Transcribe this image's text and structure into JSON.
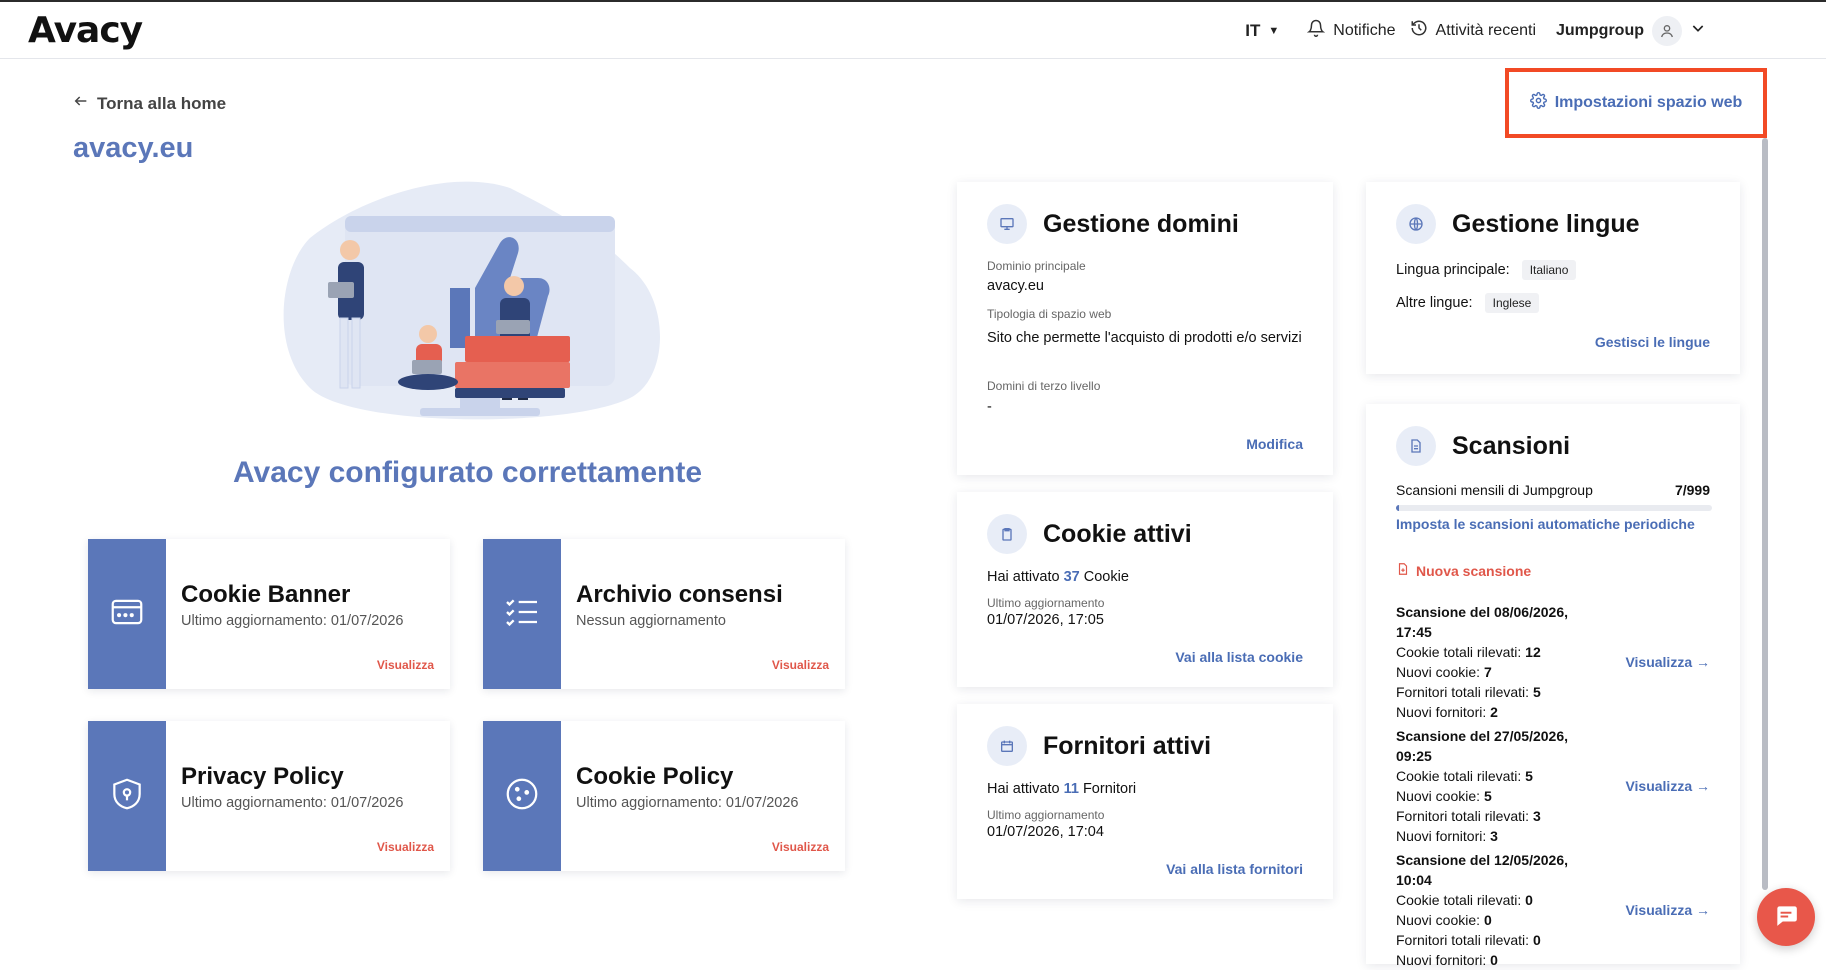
{
  "header": {
    "logo": "Avacy",
    "language": "IT",
    "notifications": "Notifiche",
    "recent_activity": "Attività recenti",
    "organization": "Jumpgroup"
  },
  "page": {
    "back_label": "Torna alla home",
    "site_title": "avacy.eu",
    "settings_label": "Impostazioni spazio web",
    "status_message": "Avacy configurato correttamente"
  },
  "tiles": [
    {
      "title": "Cookie Banner",
      "subtitle": "Ultimo aggiornamento: 01/07/2026",
      "link": "Visualizza",
      "icon": "browser-window-icon"
    },
    {
      "title": "Archivio consensi",
      "subtitle": "Nessun aggiornamento",
      "link": "Visualizza",
      "icon": "checklist-icon"
    },
    {
      "title": "Privacy Policy",
      "subtitle": "Ultimo aggiornamento: 01/07/2026",
      "link": "Visualizza",
      "icon": "shield-icon"
    },
    {
      "title": "Cookie Policy",
      "subtitle": "Ultimo aggiornamento: 01/07/2026",
      "link": "Visualizza",
      "icon": "cookie-icon"
    }
  ],
  "domains": {
    "title": "Gestione domini",
    "main_domain_label": "Dominio principale",
    "main_domain": "avacy.eu",
    "type_label": "Tipologia di spazio web",
    "type_value": "Sito che permette l'acquisto di prodotti e/o servizi",
    "third_level_label": "Domini di terzo livello",
    "third_level_value": "-",
    "action": "Modifica"
  },
  "cookies": {
    "title": "Cookie attivi",
    "prefix": "Hai attivato",
    "count": "37",
    "suffix": "Cookie",
    "updated_label": "Ultimo aggiornamento",
    "updated_value": "01/07/2026, 17:05",
    "action": "Vai alla lista cookie"
  },
  "vendors": {
    "title": "Fornitori attivi",
    "prefix": "Hai attivato",
    "count": "11",
    "suffix": "Fornitori",
    "updated_label": "Ultimo aggiornamento",
    "updated_value": "01/07/2026, 17:04",
    "action": "Vai alla lista fornitori"
  },
  "languages": {
    "title": "Gestione lingue",
    "primary_label": "Lingua principale:",
    "primary_value": "Italiano",
    "others_label": "Altre lingue:",
    "others_value": "Inglese",
    "action": "Gestisci le lingue"
  },
  "scans": {
    "title": "Scansioni",
    "monthly_label": "Scansioni mensili di Jumpgroup",
    "monthly_value": "7/999",
    "monthly_used": 7,
    "monthly_total": 999,
    "auto_link": "Imposta le scansioni automatiche periodiche",
    "new_scan": "Nuova scansione",
    "labels": {
      "cookies_total": "Cookie totali rilevati:",
      "cookies_new": "Nuovi cookie:",
      "vendors_total": "Fornitori totali rilevati:",
      "vendors_new": "Nuovi fornitori:"
    },
    "entries": [
      {
        "heading": "Scansione del 08/06/2026, 17:45",
        "cookies_total": "12",
        "cookies_new": "7",
        "vendors_total": "5",
        "vendors_new": "2",
        "link": "Visualizza"
      },
      {
        "heading": "Scansione del 27/05/2026, 09:25",
        "cookies_total": "5",
        "cookies_new": "5",
        "vendors_total": "3",
        "vendors_new": "3",
        "link": "Visualizza"
      },
      {
        "heading": "Scansione del 12/05/2026, 10:04",
        "cookies_total": "0",
        "cookies_new": "0",
        "vendors_total": "0",
        "vendors_new": "0",
        "link": "Visualizza"
      }
    ]
  },
  "colors": {
    "brand": "#5b77b9",
    "link": "#4a6db5",
    "accent": "#e0574a",
    "highlight": "#f24a25"
  }
}
